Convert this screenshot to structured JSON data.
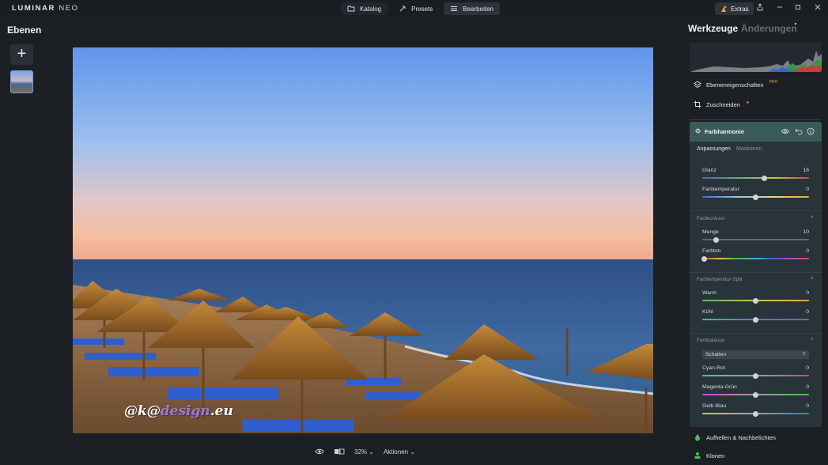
{
  "app": {
    "logo_main": "LUMINAR",
    "logo_sub": "NEO",
    "nav": [
      {
        "label": "Katalog",
        "icon": "folder-icon"
      },
      {
        "label": "Presets",
        "icon": "presets-icon"
      },
      {
        "label": "Bearbeiten",
        "icon": "sliders-icon"
      }
    ],
    "extras_label": "Extras",
    "accent": "#6aa0d9"
  },
  "left": {
    "title": "Ebenen",
    "add_label": "+"
  },
  "photo": {
    "watermark_prefix": "@k@",
    "watermark_design": "design",
    "watermark_suffix": ".eu"
  },
  "bottom": {
    "zoom": "32%",
    "actions_label": "Aktionen"
  },
  "right": {
    "tab_tools": "Werkzeuge",
    "tab_changes": "Änderungen",
    "layer_props": "Ebeneneigenschaften",
    "layer_props_badge": "PRO",
    "crop": "Zuschneiden",
    "tool_title": "Farbharmonie",
    "subtab_adjust": "Anpassungen",
    "subtab_mask": "Maskieren",
    "sliders_main": [
      {
        "label": "Glanz",
        "value": "16",
        "pos": 0.58
      },
      {
        "label": "Farbtemperatur",
        "value": "0",
        "pos": 0.5
      }
    ],
    "section_contrast": "Farbkontrast",
    "sliders_contrast": [
      {
        "label": "Menge",
        "value": "10",
        "pos": 0.13
      },
      {
        "label": "Farbton",
        "value": "0",
        "pos": 0.02
      }
    ],
    "section_split": "Farbtemperatur-Split",
    "sliders_split": [
      {
        "label": "Warm",
        "value": "0",
        "pos": 0.5
      },
      {
        "label": "Kühl",
        "value": "0",
        "pos": 0.5
      }
    ],
    "section_balance": "Farbbalance",
    "balance_select": "Schatten",
    "sliders_balance": [
      {
        "label": "Cyan-Rot",
        "value": "0",
        "pos": 0.5
      },
      {
        "label": "Magenta-Grün",
        "value": "0",
        "pos": 0.5
      },
      {
        "label": "Gelb-Blau",
        "value": "0",
        "pos": 0.5
      }
    ],
    "dodge_burn": "Aufhellen & Nachbelichten",
    "clone": "Klonen"
  }
}
